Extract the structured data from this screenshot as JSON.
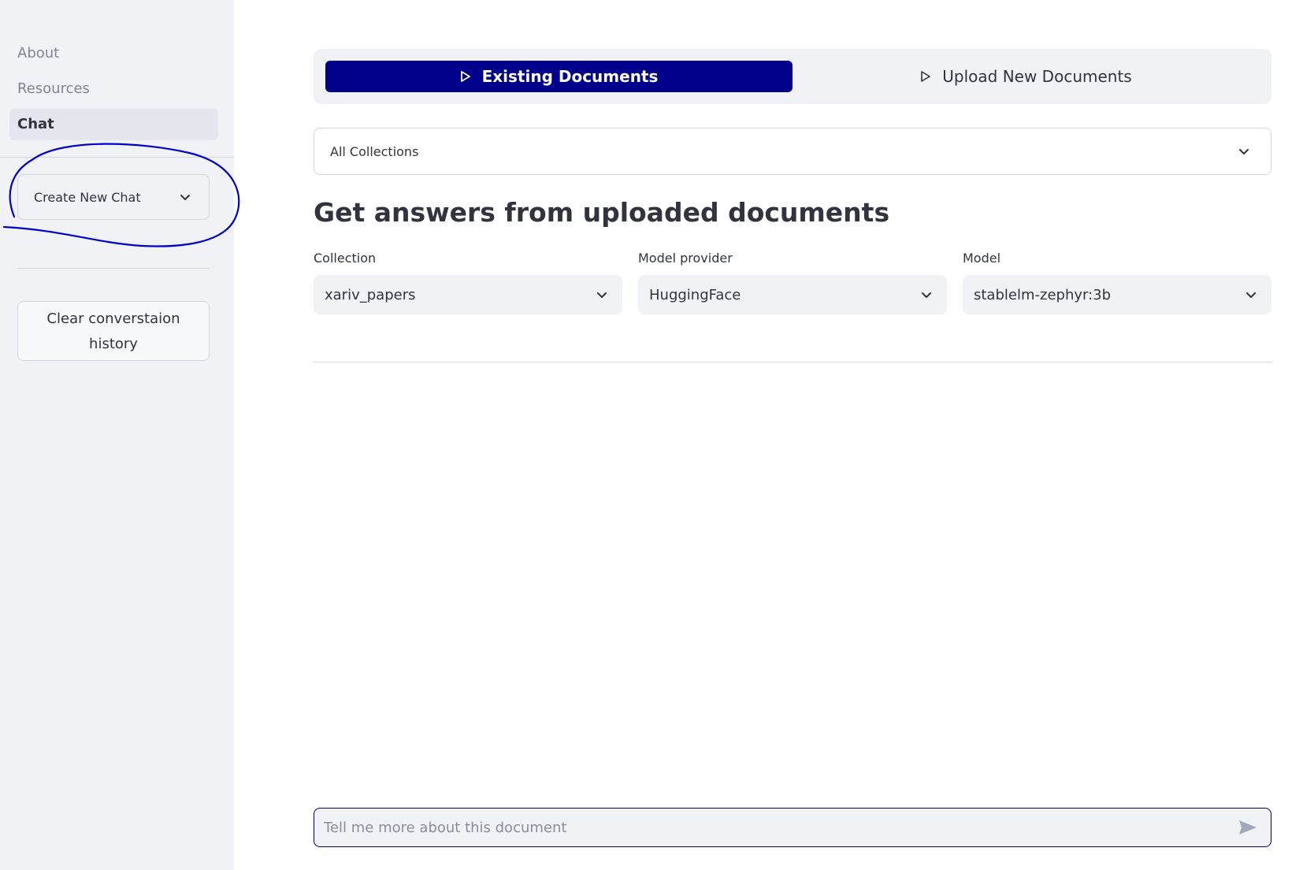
{
  "sidebar": {
    "nav": [
      {
        "label": "About",
        "active": false
      },
      {
        "label": "Resources",
        "active": false
      },
      {
        "label": "Chat",
        "active": true
      }
    ],
    "new_chat_select": "Create New Chat",
    "clear_button": "Clear converstaion history",
    "annotation_color": "#0000cc"
  },
  "main": {
    "tabs": [
      {
        "label": "Existing Documents",
        "active": true,
        "icon": "play-outline-icon"
      },
      {
        "label": "Upload New Documents",
        "active": false,
        "icon": "play-outline-icon"
      }
    ],
    "collections_select": "All Collections",
    "heading": "Get answers from uploaded documents",
    "fields": [
      {
        "label": "Collection",
        "value": "xariv_papers"
      },
      {
        "label": "Model provider",
        "value": "HuggingFace"
      },
      {
        "label": "Model",
        "value": "stablelm-zephyr:3b"
      }
    ],
    "chat_input": {
      "placeholder": "Tell me more about this document",
      "value": ""
    }
  },
  "colors": {
    "accent": "#00008b",
    "sidebar_bg": "#f0f2f6",
    "text": "#31333f"
  }
}
